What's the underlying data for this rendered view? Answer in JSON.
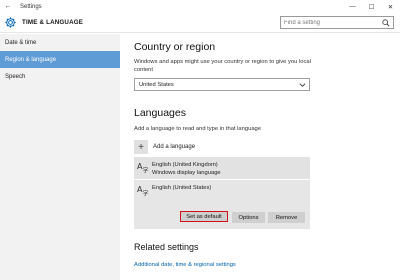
{
  "window": {
    "title": "Settings",
    "back_glyph": "←",
    "minimize_glyph": "—",
    "maximize_glyph": "☐",
    "close_glyph": "✕"
  },
  "header": {
    "title": "TIME & LANGUAGE",
    "icon": "gear-icon",
    "search_placeholder": "Find a setting"
  },
  "sidebar": {
    "items": [
      {
        "label": "Date & time",
        "active": false
      },
      {
        "label": "Region & language",
        "active": true
      },
      {
        "label": "Speech",
        "active": false
      }
    ]
  },
  "region": {
    "heading": "Country or region",
    "description": "Windows and apps might use your country or region to give you local content",
    "selected_country": "United States"
  },
  "languages": {
    "heading": "Languages",
    "description": "Add a language to read and type in that language",
    "add_label": "Add a language",
    "items": [
      {
        "name": "English (United Kingdom)",
        "subtitle": "Windows display language"
      },
      {
        "name": "English (United States)",
        "subtitle": ""
      }
    ],
    "buttons": {
      "set_default": "Set as default",
      "options": "Options",
      "remove": "Remove"
    }
  },
  "related": {
    "heading": "Related settings",
    "link": "Additional date, time & regional settings"
  },
  "colors": {
    "accent": "#5f9bd5",
    "highlight_border": "#d0121b",
    "link": "#0063b1"
  }
}
